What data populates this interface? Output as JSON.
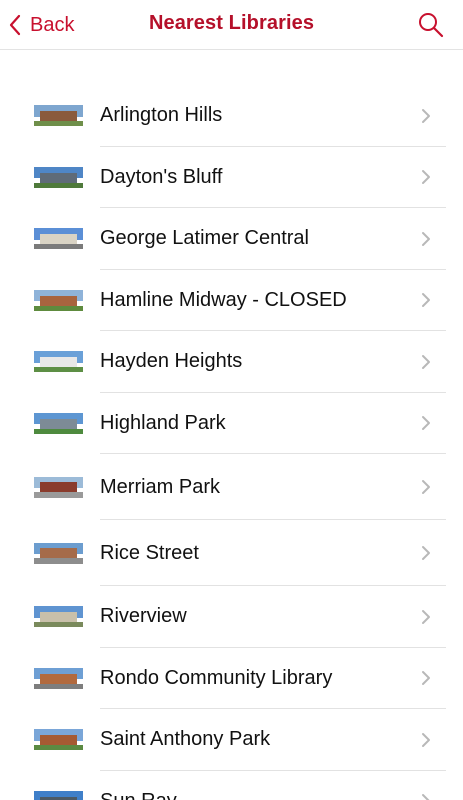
{
  "nav": {
    "back_label": "Back",
    "title": "Nearest Libraries",
    "accent_color": "#c8102e",
    "back_icon": "chevron-left-icon",
    "search_icon": "search-icon"
  },
  "libraries": [
    {
      "name": "Arlington Hills",
      "sky": "#7ea6cf",
      "bldg": "#8a5a3c",
      "ground": "#6f8f4a"
    },
    {
      "name": "Dayton's Bluff",
      "sky": "#4f86c6",
      "bldg": "#5f6b78",
      "ground": "#4f7a3b"
    },
    {
      "name": "George Latimer Central",
      "sky": "#5b8fd6",
      "bldg": "#d9d3c4",
      "ground": "#7b7b7b"
    },
    {
      "name": "Hamline Midway - CLOSED",
      "sky": "#8fb3d9",
      "bldg": "#a8643f",
      "ground": "#5e8b3e"
    },
    {
      "name": "Hayden Heights",
      "sky": "#6aa0d8",
      "bldg": "#e8e8e8",
      "ground": "#5d8f45"
    },
    {
      "name": "Highland Park",
      "sky": "#5d96d2",
      "bldg": "#7d8b96",
      "ground": "#4e8a3e"
    },
    {
      "name": "Merriam Park",
      "sky": "#9cbbd8",
      "bldg": "#8a3b2c",
      "ground": "#9a9a9a"
    },
    {
      "name": "Rice Street",
      "sky": "#6c9dcf",
      "bldg": "#a56b4a",
      "ground": "#8d8d8d"
    },
    {
      "name": "Riverview",
      "sky": "#5f94d1",
      "bldg": "#c9c0aa",
      "ground": "#7a8a5c"
    },
    {
      "name": "Rondo Community Library",
      "sky": "#6e9fd4",
      "bldg": "#b26a3e",
      "ground": "#7e7e7e"
    },
    {
      "name": "Saint Anthony Park",
      "sky": "#7aa6d8",
      "bldg": "#a55a33",
      "ground": "#5b8a42"
    },
    {
      "name": "Sun Ray",
      "sky": "#3f7fc9",
      "bldg": "#4c5a66",
      "ground": "#5b8a42"
    }
  ],
  "row_chevron_icon": "chevron-right-icon"
}
